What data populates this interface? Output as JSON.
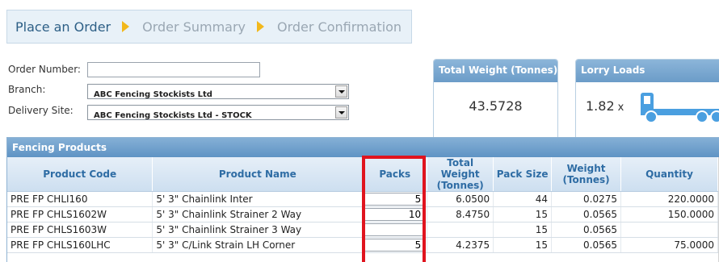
{
  "steps": [
    {
      "label": "Place an Order"
    },
    {
      "label": "Order Summary"
    },
    {
      "label": "Order Confirmation"
    }
  ],
  "form": {
    "order_number_label": "Order Number:",
    "order_number_value": "",
    "branch_label": "Branch:",
    "branch_value": "ABC Fencing Stockists Ltd",
    "delivery_label": "Delivery Site:",
    "delivery_value": "ABC Fencing Stockists Ltd - STOCK"
  },
  "summary": {
    "total_weight_title": "Total Weight (Tonnes)",
    "total_weight_value": "43.5728",
    "lorry_title": "Lorry Loads",
    "lorry_value": "1.82",
    "lorry_multiplier": "x",
    "lorry_icon": "truck-icon"
  },
  "products": {
    "title": "Fencing Products",
    "columns": [
      "Product Code",
      "Product Name",
      "Packs",
      "Total Weight (Tonnes)",
      "Pack Size",
      "Weight (Tonnes)",
      "Quantity"
    ],
    "rows": [
      {
        "code": "PRE FP CHLI160",
        "name": "5' 3\" Chainlink Inter",
        "packs": "5",
        "total_weight": "6.0500",
        "pack_size": "44",
        "weight": "0.0275",
        "quantity": "220.0000"
      },
      {
        "code": "PRE FP CHLS1602W",
        "name": "5' 3\" Chainlink Strainer 2 Way",
        "packs": "10",
        "total_weight": "8.4750",
        "pack_size": "15",
        "weight": "0.0565",
        "quantity": "150.0000"
      },
      {
        "code": "PRE FP CHLS1603W",
        "name": "5' 3\" Chainlink Strainer 3 Way",
        "packs": "",
        "total_weight": "",
        "pack_size": "15",
        "weight": "0.0565",
        "quantity": ""
      },
      {
        "code": "PRE FP CHLS160LHC",
        "name": "5' 3\" C/Link Strain LH Corner",
        "packs": "5",
        "total_weight": "4.2375",
        "pack_size": "15",
        "weight": "0.0565",
        "quantity": "75.0000"
      }
    ]
  },
  "colors": {
    "accent": "#6b9cc8",
    "header_text": "#2e6ca4",
    "step_arrow": "#f2b81c",
    "highlight": "#e0141e",
    "truck": "#4a9fe0"
  }
}
